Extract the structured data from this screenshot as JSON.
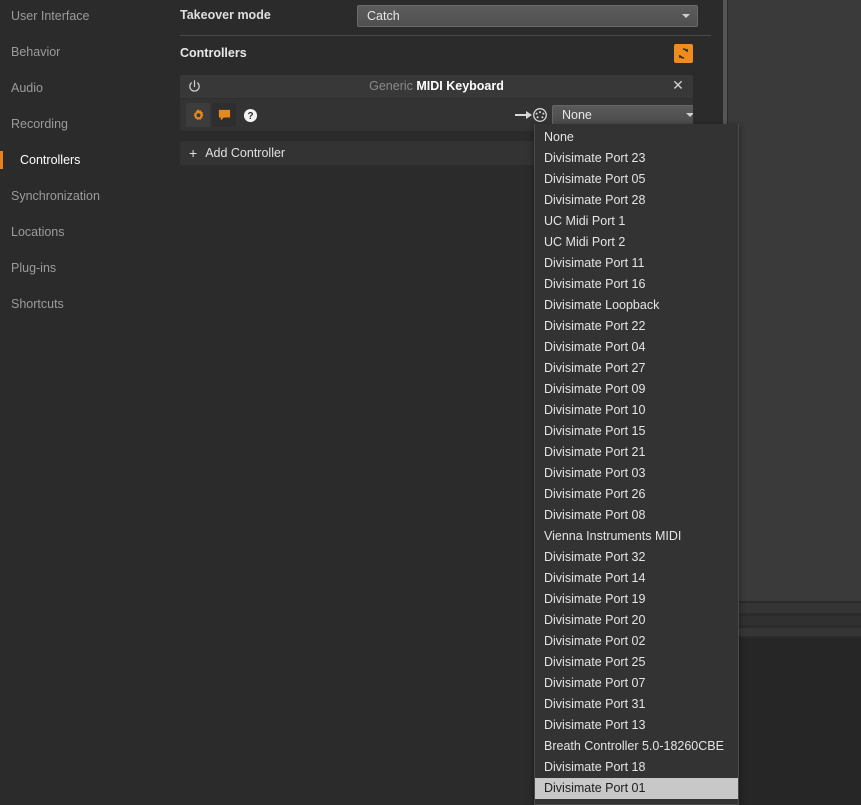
{
  "sidebar": {
    "items": [
      {
        "label": "User Interface",
        "active": false
      },
      {
        "label": "Behavior",
        "active": false
      },
      {
        "label": "Audio",
        "active": false
      },
      {
        "label": "Recording",
        "active": false
      },
      {
        "label": "Controllers",
        "active": true
      },
      {
        "label": "Synchronization",
        "active": false
      },
      {
        "label": "Locations",
        "active": false
      },
      {
        "label": "Plug-ins",
        "active": false
      },
      {
        "label": "Shortcuts",
        "active": false
      }
    ]
  },
  "content": {
    "takeover": {
      "label": "Takeover mode",
      "value": "Catch"
    },
    "controllers_section": {
      "title": "Controllers",
      "refresh_icon": "refresh-icon"
    },
    "controller": {
      "power_icon": "power-icon",
      "name_brand": "Generic",
      "name_model": "MIDI Keyboard",
      "close_icon": "close-icon",
      "gear_icon": "gear-icon",
      "chat_icon": "speech-bubble-icon",
      "help_icon": "help-icon",
      "midi_out_icon": "midi-output-icon",
      "port_value": "None"
    },
    "add_controller": {
      "plus": "+",
      "label": "Add Controller"
    }
  },
  "dropdown": {
    "options": [
      "None",
      "Divisimate Port 23",
      "Divisimate Port 05",
      "Divisimate Port 28",
      "UC Midi Port 1",
      "UC Midi Port 2",
      "Divisimate Port 11",
      "Divisimate Port 16",
      "Divisimate Loopback",
      "Divisimate Port 22",
      "Divisimate Port 04",
      "Divisimate Port 27",
      "Divisimate Port 09",
      "Divisimate Port 10",
      "Divisimate Port 15",
      "Divisimate Port 21",
      "Divisimate Port 03",
      "Divisimate Port 26",
      "Divisimate Port 08",
      "Vienna Instruments MIDI",
      "Divisimate Port 32",
      "Divisimate Port 14",
      "Divisimate Port 19",
      "Divisimate Port 20",
      "Divisimate Port 02",
      "Divisimate Port 25",
      "Divisimate Port 07",
      "Divisimate Port 31",
      "Divisimate Port 13",
      "Breath Controller 5.0-18260CBE",
      "Divisimate Port 18",
      "Divisimate Port 01"
    ],
    "highlighted": "Divisimate Port 01"
  },
  "colors": {
    "accent": "#e8821e",
    "refresh_button": "#f08c1e",
    "panel": "#333333",
    "background": "#2b2b2b",
    "highlight": "#c8c8c8"
  }
}
